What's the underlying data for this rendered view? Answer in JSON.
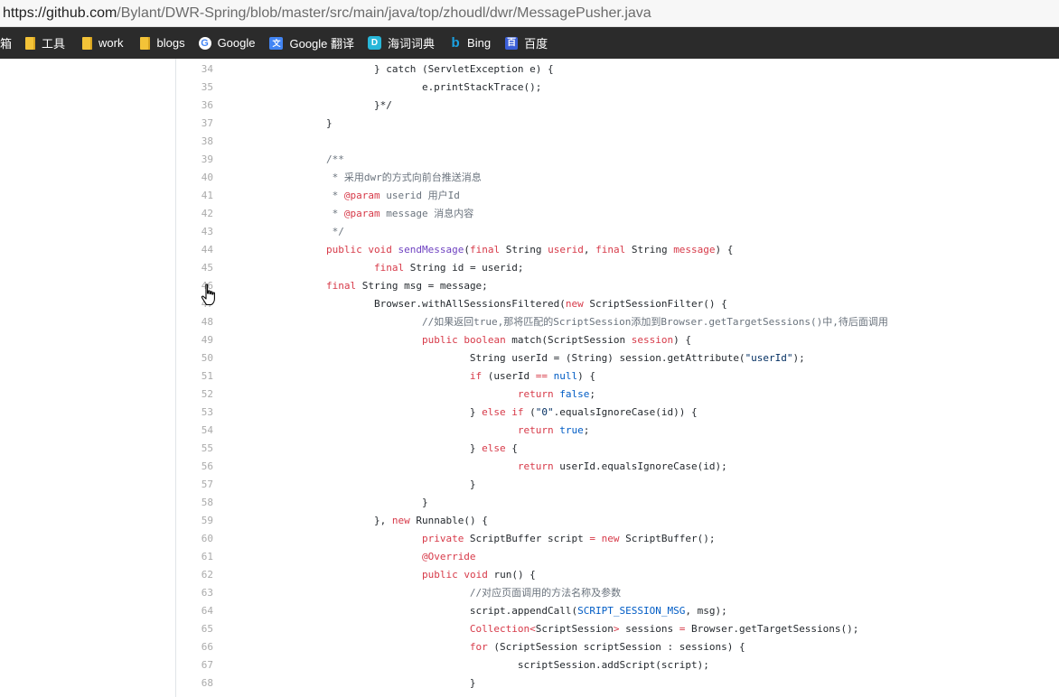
{
  "browser": {
    "url_host": "https://github.com",
    "url_path": "/Bylant/DWR-Spring/blob/master/src/main/java/top/zhoudl/dwr/MessagePusher.java"
  },
  "bookmarks": [
    {
      "label": "邮箱",
      "icon": "folder-icon"
    },
    {
      "label": "工具",
      "icon": "folder-icon"
    },
    {
      "label": "work",
      "icon": "folder-icon"
    },
    {
      "label": "blogs",
      "icon": "folder-icon"
    },
    {
      "label": "Google",
      "icon": "google-icon"
    },
    {
      "label": "Google 翻译",
      "icon": "google-translate-icon"
    },
    {
      "label": "海词词典",
      "icon": "dict-icon"
    },
    {
      "label": "Bing",
      "icon": "bing-icon"
    },
    {
      "label": "百度",
      "icon": "baidu-icon"
    }
  ],
  "icon_glyphs": {
    "google": "G",
    "gtrans": "文",
    "dict": "D",
    "bing": "b",
    "baidu": "百"
  },
  "colors": {
    "keyword": "#d73a49",
    "string": "#032f62",
    "constant": "#005cc5",
    "comment": "#6a737d",
    "line_number": "#aaaaaa",
    "bookmark_bar": "#2b2b2b"
  },
  "code": {
    "lines": [
      {
        "n": "34",
        "segs": [
          [
            "                ",
            ""
          ],
          [
            "} catch (ServletException e) {",
            ""
          ]
        ]
      },
      {
        "n": "35",
        "segs": [
          [
            "                        e.printStackTrace();",
            ""
          ]
        ]
      },
      {
        "n": "36",
        "segs": [
          [
            "                }*/",
            ""
          ]
        ]
      },
      {
        "n": "37",
        "segs": [
          [
            "        }",
            ""
          ]
        ]
      },
      {
        "n": "38",
        "segs": []
      },
      {
        "n": "39",
        "segs": [
          [
            "        /**",
            "c-com"
          ]
        ]
      },
      {
        "n": "40",
        "segs": [
          [
            "         * 采用dwr的方式向前台推送消息",
            "c-com"
          ]
        ]
      },
      {
        "n": "41",
        "segs": [
          [
            "         * ",
            "c-com"
          ],
          [
            "@param",
            "c-kw"
          ],
          [
            " userid 用户Id",
            "c-com"
          ]
        ]
      },
      {
        "n": "42",
        "segs": [
          [
            "         * ",
            "c-com"
          ],
          [
            "@param",
            "c-kw"
          ],
          [
            " message 消息内容",
            "c-com"
          ]
        ]
      },
      {
        "n": "43",
        "segs": [
          [
            "         */",
            "c-com"
          ]
        ]
      },
      {
        "n": "44",
        "segs": [
          [
            "        ",
            ""
          ],
          [
            "public",
            "c-kw"
          ],
          [
            " ",
            ""
          ],
          [
            "void",
            "c-kw"
          ],
          [
            " ",
            ""
          ],
          [
            "sendMessage",
            "c-fn"
          ],
          [
            "(",
            ""
          ],
          [
            "final",
            "c-kw"
          ],
          [
            " String ",
            ""
          ],
          [
            "userid",
            "c-kw"
          ],
          [
            ", ",
            ""
          ],
          [
            "final",
            "c-kw"
          ],
          [
            " String ",
            ""
          ],
          [
            "message",
            "c-kw"
          ],
          [
            ") {",
            ""
          ]
        ]
      },
      {
        "n": "45",
        "segs": [
          [
            "                ",
            ""
          ],
          [
            "final",
            "c-kw"
          ],
          [
            " String id = userid;",
            ""
          ]
        ]
      },
      {
        "n": "46",
        "segs": [
          [
            "        ",
            ""
          ],
          [
            "final",
            "c-kw"
          ],
          [
            " String msg = message;",
            ""
          ]
        ]
      },
      {
        "n": "47",
        "segs": [
          [
            "                Browser.withAllSessionsFiltered(",
            ""
          ],
          [
            "new",
            "c-kw"
          ],
          [
            " ScriptSessionFilter() {",
            ""
          ]
        ]
      },
      {
        "n": "48",
        "segs": [
          [
            "                        //如果返回true,那将匹配的ScriptSession添加到Browser.getTargetSessions()中,待后面调用",
            "c-com"
          ]
        ]
      },
      {
        "n": "49",
        "segs": [
          [
            "                        ",
            ""
          ],
          [
            "public",
            "c-kw"
          ],
          [
            " ",
            ""
          ],
          [
            "boolean",
            "c-kw"
          ],
          [
            " match(ScriptSession ",
            ""
          ],
          [
            "session",
            "c-kw"
          ],
          [
            ") {",
            ""
          ]
        ]
      },
      {
        "n": "50",
        "segs": [
          [
            "                                String userId = (String) session.getAttribute(",
            ""
          ],
          [
            "\"userId\"",
            "c-str"
          ],
          [
            ");",
            ""
          ]
        ]
      },
      {
        "n": "51",
        "segs": [
          [
            "                                ",
            ""
          ],
          [
            "if",
            "c-kw"
          ],
          [
            " (userId ",
            ""
          ],
          [
            "==",
            "c-kw"
          ],
          [
            " ",
            ""
          ],
          [
            "null",
            "c-const"
          ],
          [
            ") {",
            ""
          ]
        ]
      },
      {
        "n": "52",
        "segs": [
          [
            "                                        ",
            ""
          ],
          [
            "return",
            "c-kw"
          ],
          [
            " ",
            ""
          ],
          [
            "false",
            "c-const"
          ],
          [
            ";",
            ""
          ]
        ]
      },
      {
        "n": "53",
        "segs": [
          [
            "                                } ",
            ""
          ],
          [
            "else",
            "c-kw"
          ],
          [
            " ",
            ""
          ],
          [
            "if",
            "c-kw"
          ],
          [
            " (",
            ""
          ],
          [
            "\"0\"",
            "c-str"
          ],
          [
            ".equalsIgnoreCase(id)) {",
            ""
          ]
        ]
      },
      {
        "n": "54",
        "segs": [
          [
            "                                        ",
            ""
          ],
          [
            "return",
            "c-kw"
          ],
          [
            " ",
            ""
          ],
          [
            "true",
            "c-const"
          ],
          [
            ";",
            ""
          ]
        ]
      },
      {
        "n": "55",
        "segs": [
          [
            "                                } ",
            ""
          ],
          [
            "else",
            "c-kw"
          ],
          [
            " {",
            ""
          ]
        ]
      },
      {
        "n": "56",
        "segs": [
          [
            "                                        ",
            ""
          ],
          [
            "return",
            "c-kw"
          ],
          [
            " userId.equalsIgnoreCase(id);",
            ""
          ]
        ]
      },
      {
        "n": "57",
        "segs": [
          [
            "                                }",
            ""
          ]
        ]
      },
      {
        "n": "58",
        "segs": [
          [
            "                        }",
            ""
          ]
        ]
      },
      {
        "n": "59",
        "segs": [
          [
            "                }, ",
            ""
          ],
          [
            "new",
            "c-kw"
          ],
          [
            " Runnable() {",
            ""
          ]
        ]
      },
      {
        "n": "60",
        "segs": [
          [
            "                        ",
            ""
          ],
          [
            "private",
            "c-kw"
          ],
          [
            " ScriptBuffer script ",
            ""
          ],
          [
            "=",
            "c-kw"
          ],
          [
            " ",
            ""
          ],
          [
            "new",
            "c-kw"
          ],
          [
            " ScriptBuffer();",
            ""
          ]
        ]
      },
      {
        "n": "61",
        "segs": [
          [
            "                        ",
            ""
          ],
          [
            "@Override",
            "c-kw"
          ]
        ]
      },
      {
        "n": "62",
        "segs": [
          [
            "                        ",
            ""
          ],
          [
            "public",
            "c-kw"
          ],
          [
            " ",
            ""
          ],
          [
            "void",
            "c-kw"
          ],
          [
            " run() {",
            ""
          ]
        ]
      },
      {
        "n": "63",
        "segs": [
          [
            "                                //对应页面调用的方法名称及参数",
            "c-com"
          ]
        ]
      },
      {
        "n": "64",
        "segs": [
          [
            "                                script.appendCall(",
            ""
          ],
          [
            "SCRIPT_SESSION_MSG",
            "c-const"
          ],
          [
            ", msg);",
            ""
          ]
        ]
      },
      {
        "n": "65",
        "segs": [
          [
            "                                ",
            ""
          ],
          [
            "Collection<",
            "c-kw"
          ],
          [
            "ScriptSession",
            ""
          ],
          [
            ">",
            "c-kw"
          ],
          [
            " sessions ",
            ""
          ],
          [
            "=",
            "c-kw"
          ],
          [
            " Browser.getTargetSessions();",
            ""
          ]
        ]
      },
      {
        "n": "66",
        "segs": [
          [
            "                                ",
            ""
          ],
          [
            "for",
            "c-kw"
          ],
          [
            " (ScriptSession scriptSession : sessions) {",
            ""
          ]
        ]
      },
      {
        "n": "67",
        "segs": [
          [
            "                                        scriptSession.addScript(script);",
            ""
          ]
        ]
      },
      {
        "n": "68",
        "segs": [
          [
            "                                }",
            ""
          ]
        ]
      }
    ]
  }
}
